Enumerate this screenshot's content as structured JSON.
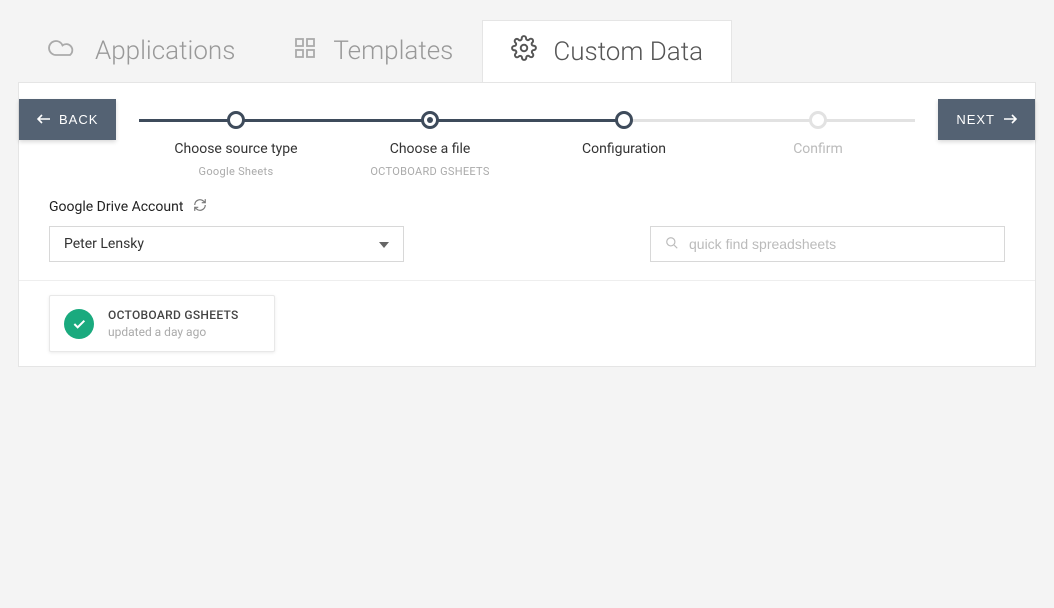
{
  "tabs": {
    "applications": "Applications",
    "templates": "Templates",
    "custom_data": "Custom Data"
  },
  "nav": {
    "back": "BACK",
    "next": "NEXT"
  },
  "stepper": {
    "steps": [
      {
        "label": "Choose source type",
        "sub": "Google Sheets"
      },
      {
        "label": "Choose a file",
        "sub": "OCTOBOARD GSHEETS"
      },
      {
        "label": "Configuration",
        "sub": ""
      },
      {
        "label": "Confirm",
        "sub": ""
      }
    ]
  },
  "account": {
    "label": "Google Drive Account",
    "selected": "Peter Lensky"
  },
  "search": {
    "placeholder": "quick find spreadsheets"
  },
  "results": [
    {
      "title": "OCTOBOARD GSHEETS",
      "subtitle": "updated a day ago"
    }
  ]
}
